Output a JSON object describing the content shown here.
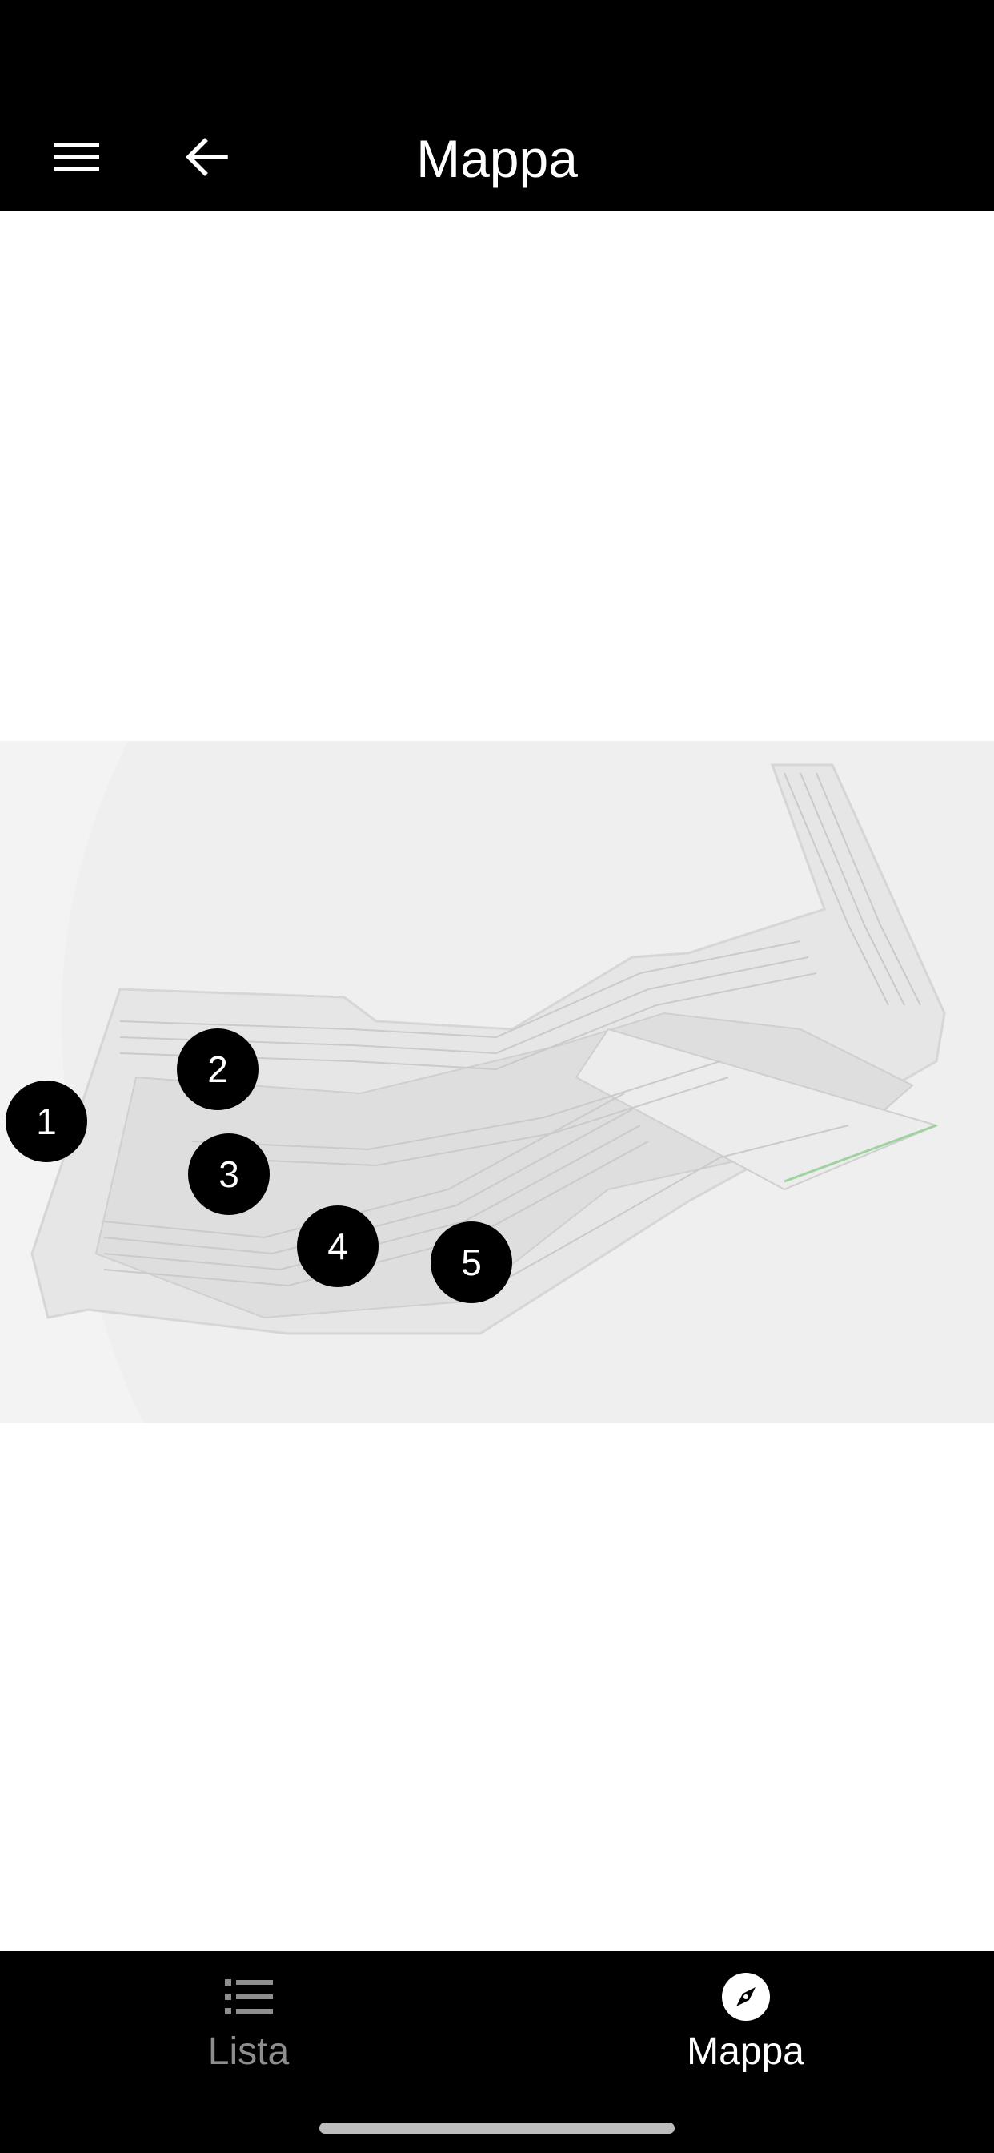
{
  "header": {
    "title": "Mappa",
    "menu_icon": "hamburger-menu-icon",
    "back_icon": "arrow-left-icon"
  },
  "map": {
    "markers": [
      {
        "label": "1"
      },
      {
        "label": "2"
      },
      {
        "label": "3"
      },
      {
        "label": "4"
      },
      {
        "label": "5"
      }
    ]
  },
  "bottom_nav": {
    "tabs": [
      {
        "label": "Lista",
        "icon": "list-icon",
        "active": false
      },
      {
        "label": "Mappa",
        "icon": "compass-icon",
        "active": true
      }
    ]
  },
  "colors": {
    "bar_background": "#000000",
    "active_tab": "#ffffff",
    "inactive_tab": "#8e8e8e",
    "map_background": "#f3f3f3"
  }
}
